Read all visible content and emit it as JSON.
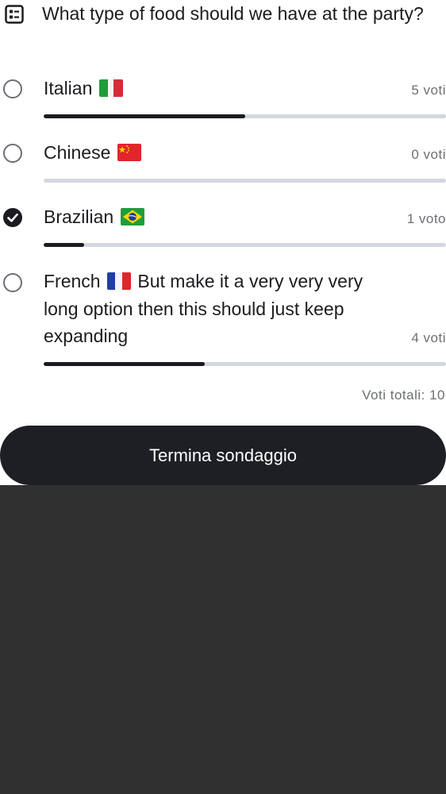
{
  "poll": {
    "question": "What type of food should we have at the party?",
    "icon": "poll-list-icon",
    "options": [
      {
        "label": "Italian",
        "flag": "italy-flag-icon",
        "extra": "",
        "votes_text": "5 voti",
        "fraction": 0.5,
        "selected": false
      },
      {
        "label": "Chinese",
        "flag": "china-flag-icon",
        "extra": "",
        "votes_text": "0 voti",
        "fraction": 0.0,
        "selected": false
      },
      {
        "label": "Brazilian",
        "flag": "brazil-flag-icon",
        "extra": "",
        "votes_text": "1 voto",
        "fraction": 0.1,
        "selected": true
      },
      {
        "label": "French",
        "flag": "france-flag-icon",
        "extra": "But make it a very very very long option then this should just keep expanding",
        "votes_text": "4 voti",
        "fraction": 0.4,
        "selected": false
      }
    ],
    "total_votes": "Voti totali: 10",
    "end_button": "Termina sondaggio"
  },
  "colors": {
    "text": "#1b1c20",
    "muted": "#6c6f76",
    "track": "#d3d7df",
    "fill": "#1b1c20",
    "button": "#1e1f24",
    "backdrop": "#303030"
  }
}
